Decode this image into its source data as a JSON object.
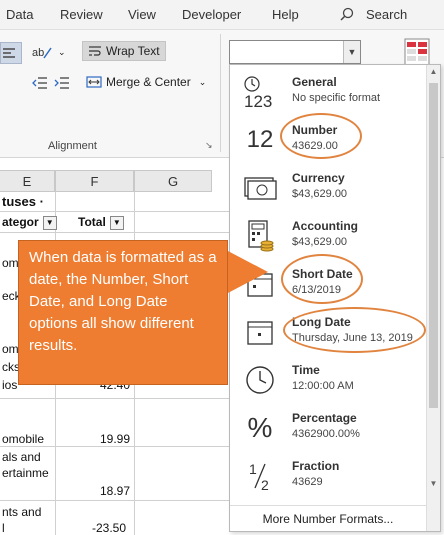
{
  "menubar": {
    "items": [
      "Data",
      "Review",
      "View",
      "Developer",
      "Help"
    ],
    "search_label": "Search"
  },
  "ribbon": {
    "wrap_text": "Wrap Text",
    "merge_center": "Merge & Center",
    "alignment_group": "Alignment",
    "format_box_value": ""
  },
  "sheet": {
    "columns": [
      "E",
      "F",
      "G"
    ],
    "header_text": "tuses &middot;",
    "categ_header": "ategor",
    "total_header": "Total",
    "cells": {
      "r1": "omo",
      "r2": "eck",
      "r3": "om",
      "r4": "cks",
      "r5": "ios",
      "r5_val": "42.40",
      "r6": "omobile",
      "r6_val": "19.99",
      "r7": "als and",
      "r8": "ertainme",
      "r8_val": "18.97",
      "r9": "nts and",
      "r10": "l",
      "r10_val": "-23.50"
    }
  },
  "formats": [
    {
      "name": "General",
      "value": "No specific format",
      "icon": "general-123-icon"
    },
    {
      "name": "Number",
      "value": "43629.00",
      "icon": "number-12-icon"
    },
    {
      "name": "Currency",
      "value": "$43,629.00",
      "icon": "currency-icon"
    },
    {
      "name": "Accounting",
      "value": "$43,629.00",
      "icon": "accounting-icon"
    },
    {
      "name": "Short Date",
      "value": "6/13/2019",
      "icon": "short-date-icon"
    },
    {
      "name": "Long Date",
      "value": "Thursday, June 13, 2019",
      "icon": "long-date-icon"
    },
    {
      "name": "Time",
      "value": "12:00:00 AM",
      "icon": "clock-icon"
    },
    {
      "name": "Percentage",
      "value": "4362900.00%",
      "icon": "percent-icon"
    },
    {
      "name": "Fraction",
      "value": "43629",
      "icon": "fraction-icon"
    }
  ],
  "more_formats": "More Number Formats...",
  "callout": {
    "text": "When data is formatted as a date, the Number, Short Date, and Long Date options all show different results."
  },
  "colors": {
    "callout": "#ee7d31",
    "highlight_oval": "#e0843f"
  }
}
